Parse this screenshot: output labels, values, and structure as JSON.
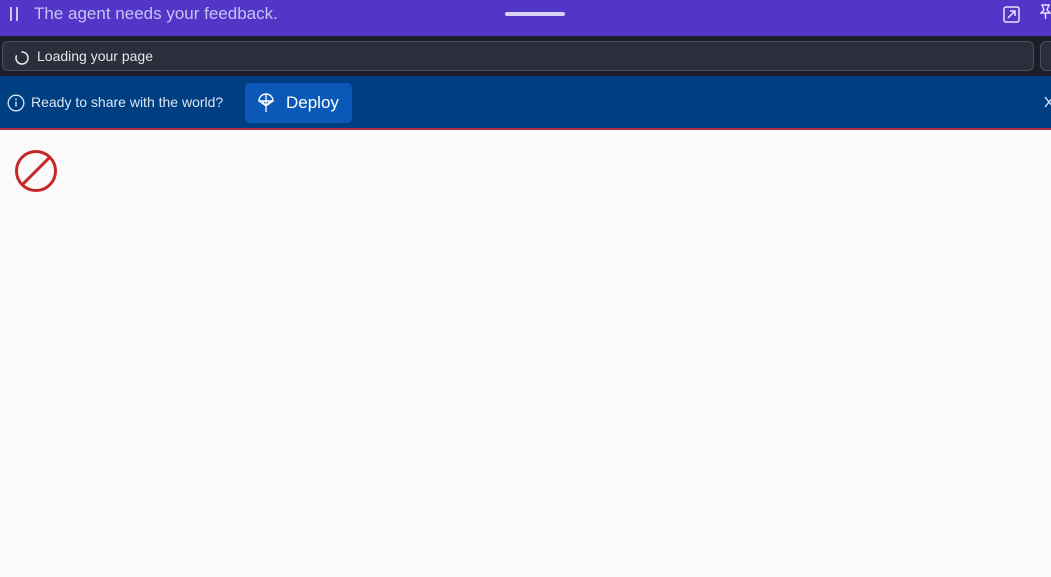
{
  "agent_bar": {
    "message": "The agent needs your feedback.",
    "background": "#5136c8",
    "icons": [
      "pause-icon",
      "expand-icon",
      "pin-icon"
    ]
  },
  "address_bar": {
    "status_text": "Loading your page",
    "icons": [
      "spinner-icon"
    ]
  },
  "deploy_banner": {
    "text": "Ready to share with the world?",
    "button_label": "Deploy",
    "background": "#003e82",
    "button_color": "#0a59b8",
    "icons": [
      "info-icon",
      "deploy-icon",
      "close-icon"
    ]
  },
  "content": {
    "icons": [
      "blocked-icon"
    ],
    "blocked_color": "#c62828"
  }
}
